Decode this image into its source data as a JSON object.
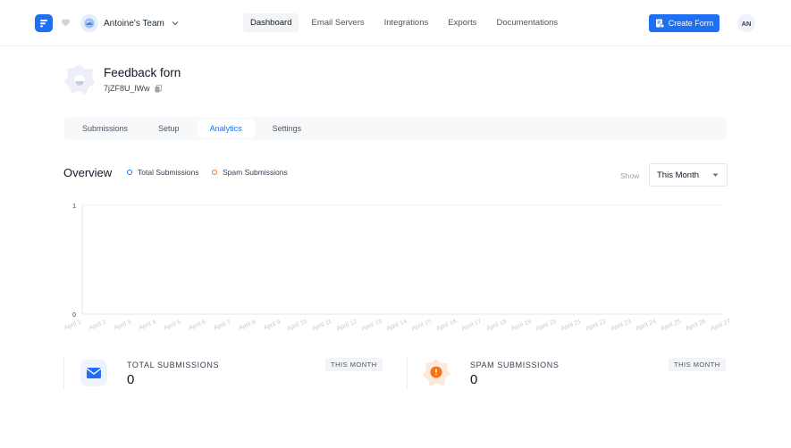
{
  "colors": {
    "accent": "#1f6ff2",
    "spam": "#f97316",
    "avatar_bg": "#eef2fa"
  },
  "header": {
    "team_name": "Antoine's Team",
    "nav": [
      "Dashboard",
      "Email Servers",
      "Integrations",
      "Exports",
      "Documentations"
    ],
    "active_nav": "Dashboard",
    "create_button": "Create Form",
    "user_initials": "AN"
  },
  "form": {
    "title": "Feedback forn",
    "id": "7jZF8U_lWw",
    "tabs": [
      "Submissions",
      "Setup",
      "Analytics",
      "Settings"
    ],
    "active_tab": "Analytics"
  },
  "overview": {
    "title": "Overview",
    "legend": [
      "Total Submissions",
      "Spam Submissions"
    ],
    "show_label": "Show",
    "period": "This Month"
  },
  "chart_data": {
    "type": "line",
    "x": [
      "April 1",
      "April 2",
      "April 3",
      "April 4",
      "April 5",
      "April 6",
      "April 7",
      "April 8",
      "April 9",
      "April 10",
      "April 11",
      "April 12",
      "April 13",
      "April 14",
      "April 15",
      "April 16",
      "April 17",
      "April 18",
      "April 19",
      "April 20",
      "April 21",
      "April 22",
      "April 23",
      "April 24",
      "April 25",
      "April 26",
      "April 27"
    ],
    "series": [
      {
        "name": "Total Submissions",
        "values": [
          0,
          0,
          0,
          0,
          0,
          0,
          0,
          0,
          0,
          0,
          0,
          0,
          0,
          0,
          0,
          0,
          0,
          0,
          0,
          0,
          0,
          0,
          0,
          0,
          0,
          0,
          0
        ]
      },
      {
        "name": "Spam Submissions",
        "values": [
          0,
          0,
          0,
          0,
          0,
          0,
          0,
          0,
          0,
          0,
          0,
          0,
          0,
          0,
          0,
          0,
          0,
          0,
          0,
          0,
          0,
          0,
          0,
          0,
          0,
          0,
          0
        ]
      }
    ],
    "yticks": [
      "1",
      "0"
    ],
    "ylim": [
      0,
      1
    ],
    "grid": true,
    "legend_position": "top-left"
  },
  "stats": [
    {
      "label": "TOTAL SUBMISSIONS",
      "value": "0",
      "badge": "THIS MONTH",
      "icon": "envelope-icon"
    },
    {
      "label": "SPAM SUBMISSIONS",
      "value": "0",
      "badge": "THIS MONTH",
      "icon": "alert-icon"
    }
  ]
}
